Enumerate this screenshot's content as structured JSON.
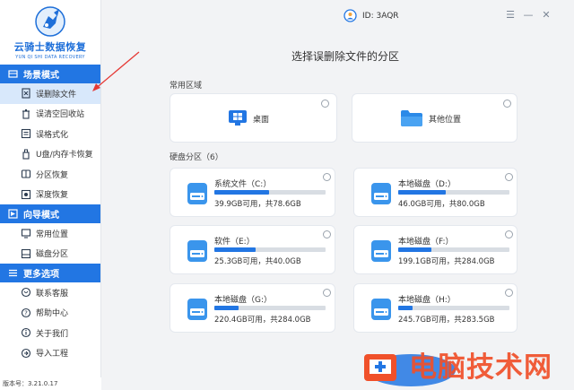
{
  "app": {
    "logo_title": "云骑士数据恢复",
    "logo_sub": "YUN QI SHI DATA RECOVERY",
    "user_id": "ID: 3AQR",
    "version": "版本号：3.21.0.17"
  },
  "sidebar": {
    "sections": [
      {
        "title": "场景模式",
        "items": [
          {
            "label": "误删除文件",
            "icon": "delete-file-icon",
            "active": true
          },
          {
            "label": "误清空回收站",
            "icon": "recycle-bin-icon"
          },
          {
            "label": "误格式化",
            "icon": "format-icon"
          },
          {
            "label": "U盘/内存卡恢复",
            "icon": "usb-icon"
          },
          {
            "label": "分区恢复",
            "icon": "partition-icon"
          },
          {
            "label": "深度恢复",
            "icon": "deep-recovery-icon"
          }
        ]
      },
      {
        "title": "向导模式",
        "items": [
          {
            "label": "常用位置",
            "icon": "common-location-icon"
          },
          {
            "label": "磁盘分区",
            "icon": "disk-partition-icon"
          }
        ]
      },
      {
        "title": "更多选项",
        "items": [
          {
            "label": "联系客服",
            "icon": "support-icon"
          },
          {
            "label": "帮助中心",
            "icon": "help-icon"
          },
          {
            "label": "关于我们",
            "icon": "about-icon"
          },
          {
            "label": "导入工程",
            "icon": "import-icon"
          }
        ]
      }
    ]
  },
  "main": {
    "title": "选择误删除文件的分区",
    "common_label": "常用区域",
    "locations": [
      {
        "label": "桌面",
        "icon": "desktop-windows-icon"
      },
      {
        "label": "其他位置",
        "icon": "folder-icon"
      }
    ],
    "disk_label": "硬盘分区（6）",
    "disks": [
      {
        "name": "系统文件（C:）",
        "info": "39.9GB可用，共78.6GB",
        "used_fraction": 0.49
      },
      {
        "name": "本地磁盘（D:）",
        "info": "46.0GB可用，共80.0GB",
        "used_fraction": 0.43
      },
      {
        "name": "软件（E:）",
        "info": "25.3GB可用，共40.0GB",
        "used_fraction": 0.37
      },
      {
        "name": "本地磁盘（F:）",
        "info": "199.1GB可用，共284.0GB",
        "used_fraction": 0.3
      },
      {
        "name": "本地磁盘（G:）",
        "info": "220.4GB可用，共284.0GB",
        "used_fraction": 0.22
      },
      {
        "name": "本地磁盘（H:）",
        "info": "245.7GB可用，共283.5GB",
        "used_fraction": 0.13
      }
    ]
  },
  "watermark": {
    "text": "电脑技术网"
  },
  "colors": {
    "accent": "#2276e3",
    "active_bg": "#d8e8fb",
    "watermark": "#f0502a"
  }
}
